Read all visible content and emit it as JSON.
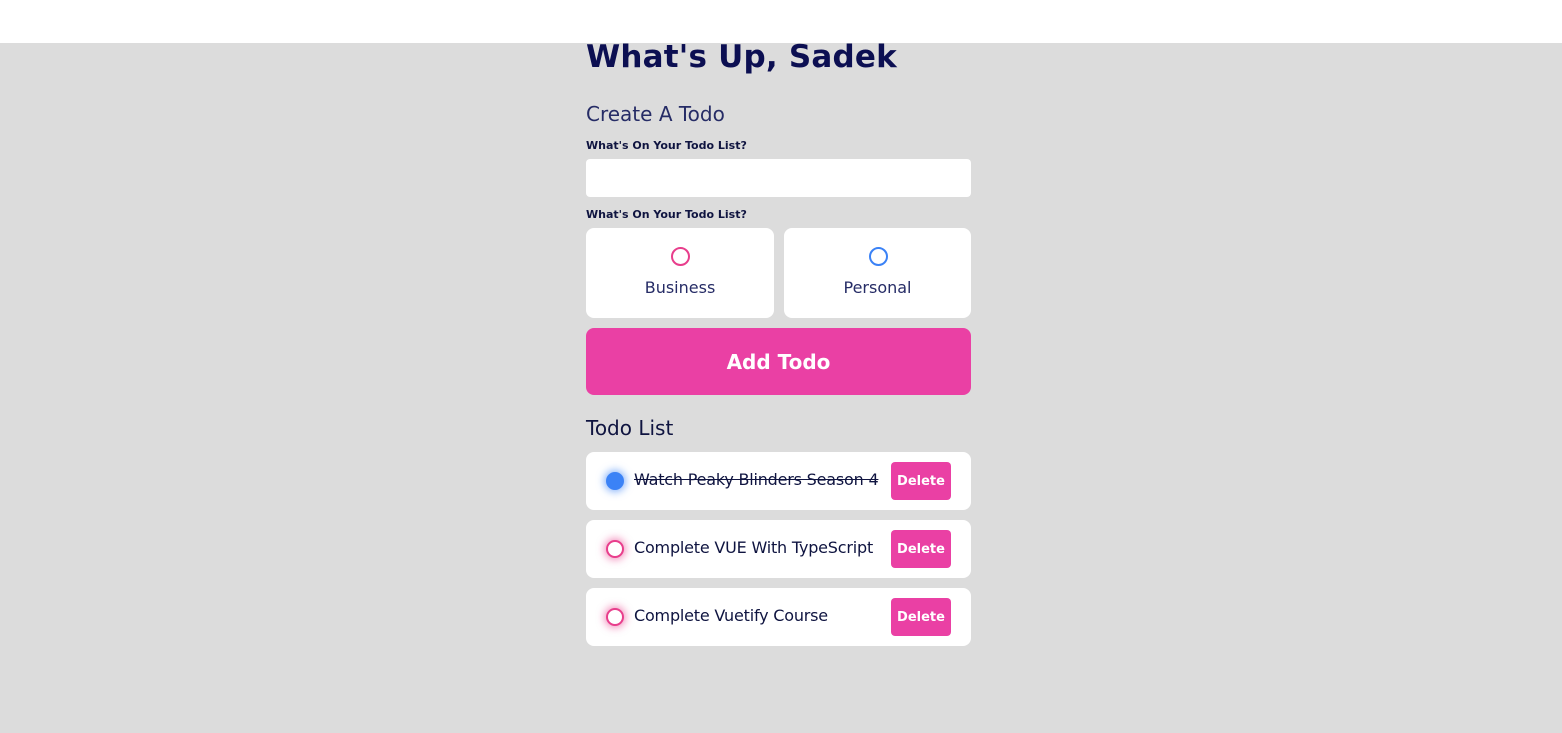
{
  "colors": {
    "accent": "#ea40a4",
    "business": "#e83e8c",
    "personal": "#3b82f6",
    "background": "#dcdcdc",
    "text": "#0f1440"
  },
  "greeting": {
    "title": "What's Up, Sadek"
  },
  "create": {
    "title": "Create A Todo",
    "content_label": "What's On Your Todo List?",
    "content_value": "",
    "category_label": "What's On Your Todo List?",
    "categories": [
      {
        "label": "Business",
        "selected": false
      },
      {
        "label": "Personal",
        "selected": false
      }
    ],
    "submit_label": "Add Todo"
  },
  "list": {
    "title": "Todo List",
    "items": [
      {
        "text": "Watch Peaky Blinders Season 4",
        "category": "personal",
        "done": true,
        "delete_label": "Delete"
      },
      {
        "text": "Complete VUE With TypeScript",
        "category": "business",
        "done": false,
        "delete_label": "Delete"
      },
      {
        "text": "Complete Vuetify Course",
        "category": "business",
        "done": false,
        "delete_label": "Delete"
      }
    ]
  }
}
